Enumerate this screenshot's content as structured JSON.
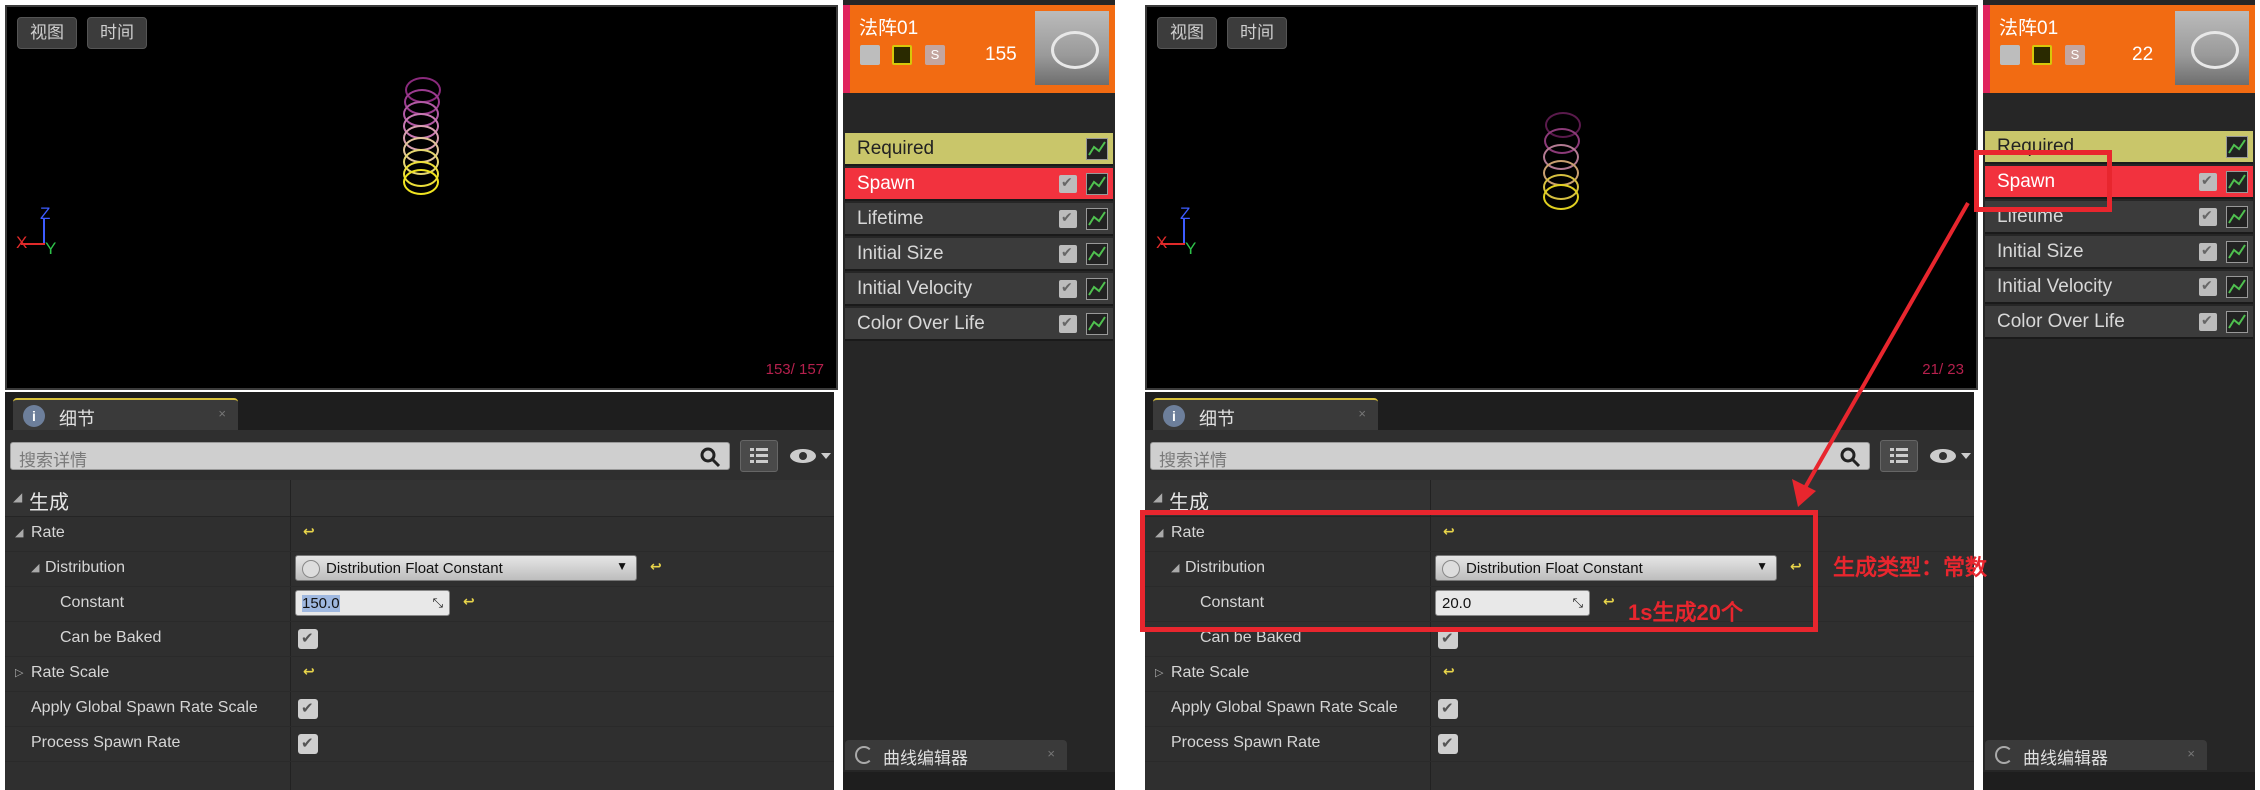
{
  "panels": [
    {
      "viewport": {
        "view_btn": "视图",
        "time_btn": "时间",
        "particle_count": "153/ 157",
        "axis_z": "Z",
        "axis_x": "X",
        "axis_y": "Y"
      },
      "details": {
        "tab_label": "细节",
        "tab_close": "×",
        "tab_icon": "i",
        "search_placeholder": "搜索详情",
        "section": "生成",
        "rows": {
          "rate": "Rate",
          "distribution": "Distribution",
          "distribution_value": "Distribution Float Constant",
          "constant": "Constant",
          "constant_value": "150.0",
          "can_be_baked": "Can be Baked",
          "rate_scale": "Rate Scale",
          "apply_global": "Apply Global Spawn Rate Scale",
          "process_spawn": "Process Spawn Rate"
        }
      },
      "emitter": {
        "title": "法阵01",
        "count": "155",
        "s_label": "S",
        "modules": [
          "Required",
          "Spawn",
          "Lifetime",
          "Initial Size",
          "Initial Velocity",
          "Color Over Life"
        ],
        "curve_tab": "曲线编辑器",
        "curve_close": "×"
      }
    },
    {
      "viewport": {
        "view_btn": "视图",
        "time_btn": "时间",
        "particle_count": "21/ 23",
        "axis_z": "Z",
        "axis_x": "X",
        "axis_y": "Y"
      },
      "details": {
        "tab_label": "细节",
        "tab_close": "×",
        "tab_icon": "i",
        "search_placeholder": "搜索详情",
        "section": "生成",
        "rows": {
          "rate": "Rate",
          "distribution": "Distribution",
          "distribution_value": "Distribution Float Constant",
          "constant": "Constant",
          "constant_value": "20.0",
          "can_be_baked": "Can be Baked",
          "rate_scale": "Rate Scale",
          "apply_global": "Apply Global Spawn Rate Scale",
          "process_spawn": "Process Spawn Rate"
        }
      },
      "emitter": {
        "title": "法阵01",
        "count": "22",
        "s_label": "S",
        "modules": [
          "Required",
          "Spawn",
          "Lifetime",
          "Initial Size",
          "Initial Velocity",
          "Color Over Life"
        ],
        "curve_tab": "曲线编辑器",
        "curve_close": "×"
      }
    }
  ],
  "annotations": {
    "type_note": "生成类型：常数",
    "constant_note": "1s生成20个"
  },
  "colors": {
    "required": "#c9c66a",
    "spawn": "#f2323e",
    "module": "#3b3b3b",
    "emitter_header": "#f26b12",
    "annotation": "#e8262e"
  }
}
